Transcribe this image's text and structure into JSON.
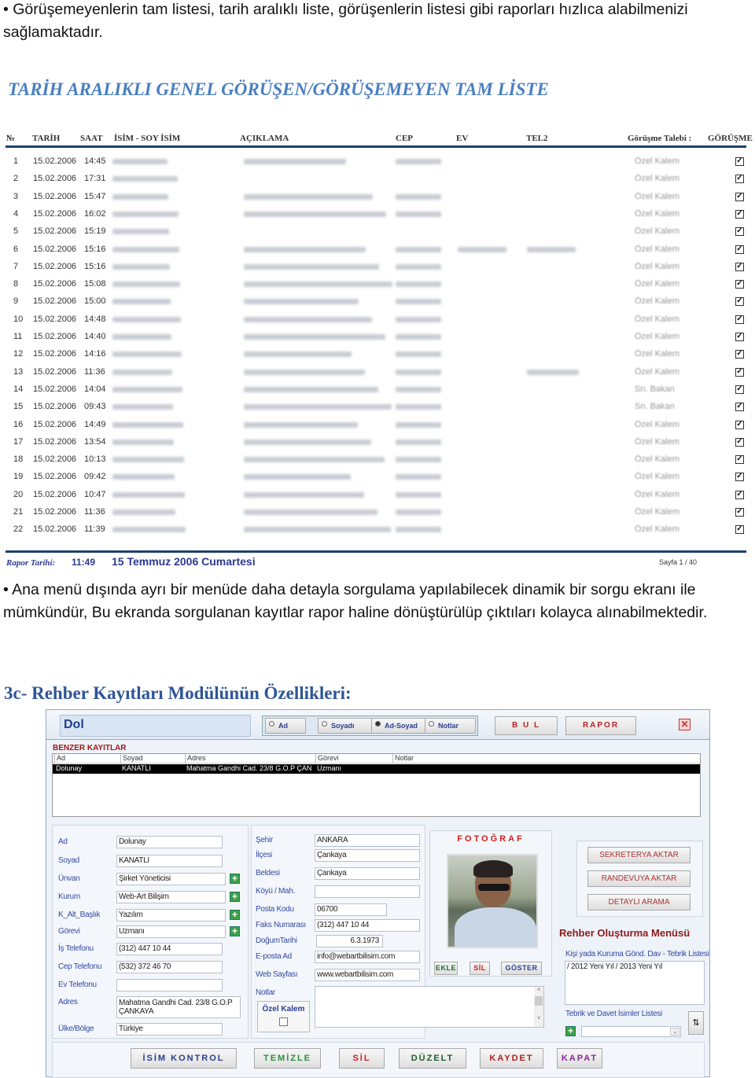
{
  "intro": "• Görüşemeyenlerin tam listesi, tarih aralıklı liste, görüşenlerin listesi gibi raporları hızlıca alabilmenizi sağlamaktadır.",
  "report_heading": "TARİH ARALIKLI GENEL GÖRÜŞEN/GÖRÜŞEMEYEN TAM LİSTE",
  "report": {
    "columns": [
      "№",
      "TARİH",
      "SAAT",
      "İSİM - SOY İSİM",
      "AÇIKLAMA",
      "CEP",
      "EV",
      "TEL2",
      "Görüşme Talebi :",
      "GÖRÜŞME"
    ],
    "rows": [
      {
        "no": "1",
        "date": "15.02.2006",
        "time": "14:45",
        "talep": "Özel Kalem",
        "checked": true
      },
      {
        "no": "2",
        "date": "15.02.2006",
        "time": "17:31",
        "talep": "Özel Kalem",
        "checked": true
      },
      {
        "no": "3",
        "date": "15.02.2006",
        "time": "15:47",
        "talep": "Özel Kalem",
        "checked": true
      },
      {
        "no": "4",
        "date": "15.02.2006",
        "time": "16:02",
        "talep": "Özel Kalem",
        "checked": true
      },
      {
        "no": "5",
        "date": "15.02.2006",
        "time": "15:19",
        "talep": "Özel Kalem",
        "checked": true
      },
      {
        "no": "6",
        "date": "15.02.2006",
        "time": "15:16",
        "talep": "Özel Kalem",
        "checked": true
      },
      {
        "no": "7",
        "date": "15.02.2006",
        "time": "15:16",
        "talep": "Özel Kalem",
        "checked": true
      },
      {
        "no": "8",
        "date": "15.02.2006",
        "time": "15:08",
        "talep": "Özel Kalem",
        "checked": true
      },
      {
        "no": "9",
        "date": "15.02.2006",
        "time": "15:00",
        "talep": "Özel Kalem",
        "checked": true
      },
      {
        "no": "10",
        "date": "15.02.2006",
        "time": "14:48",
        "talep": "Özel Kalem",
        "checked": true
      },
      {
        "no": "11",
        "date": "15.02.2006",
        "time": "14:40",
        "talep": "Özel Kalem",
        "checked": true
      },
      {
        "no": "12",
        "date": "15.02.2006",
        "time": "14:16",
        "talep": "Özel Kalem",
        "checked": true
      },
      {
        "no": "13",
        "date": "15.02.2006",
        "time": "11:36",
        "talep": "Özel Kalem",
        "checked": true
      },
      {
        "no": "14",
        "date": "15.02.2006",
        "time": "14:04",
        "talep": "Sn. Bakan",
        "checked": true
      },
      {
        "no": "15",
        "date": "15.02.2006",
        "time": "09:43",
        "talep": "Sn. Bakan",
        "checked": true
      },
      {
        "no": "16",
        "date": "15.02.2006",
        "time": "14:49",
        "talep": "Özel Kalem",
        "checked": true
      },
      {
        "no": "17",
        "date": "15.02.2006",
        "time": "13:54",
        "talep": "Özel Kalem",
        "checked": true
      },
      {
        "no": "18",
        "date": "15.02.2006",
        "time": "10:13",
        "talep": "Özel Kalem",
        "checked": true
      },
      {
        "no": "19",
        "date": "15.02.2006",
        "time": "09:42",
        "talep": "Özel Kalem",
        "checked": true
      },
      {
        "no": "20",
        "date": "15.02.2006",
        "time": "10:47",
        "talep": "Özel Kalem",
        "checked": true
      },
      {
        "no": "21",
        "date": "15.02.2006",
        "time": "11:36",
        "talep": "Özel Kalem",
        "checked": true
      },
      {
        "no": "22",
        "date": "15.02.2006",
        "time": "11:39",
        "talep": "Özel Kalem",
        "checked": true
      }
    ],
    "footer": {
      "label": "Rapor Tarihi:",
      "time": "11:49",
      "date": "15 Temmuz 2006 Cumartesi",
      "page": "Sayfa 1 / 40"
    }
  },
  "para2": "• Ana menü dışında ayrı bir menüde daha detayla sorgulama yapılabilecek dinamik bir  sorgu ekranı ile mümkündür, Bu ekranda sorgulanan kayıtlar rapor haline dönüştürülüp çıktıları kolayca alınabilmektedir.",
  "section_heading": "3c- Rehber Kayıtları Modülünün Özellikleri:",
  "app": {
    "search_value": "Dol",
    "radios": [
      {
        "label": "Ad",
        "selected": false
      },
      {
        "label": "Soyadı",
        "selected": false
      },
      {
        "label": "Ad-Soyad",
        "selected": true
      },
      {
        "label": "Notlar",
        "selected": false
      }
    ],
    "bul": "B U L",
    "rapor": "RAPOR",
    "similar_title": "BENZER KAYITLAR",
    "similar_columns": [
      "Ad",
      "Soyad",
      "Adres",
      "Görevi",
      "Notlar"
    ],
    "similar_rows": [
      [
        "Dolunay",
        "KANATLI",
        "Mahatma Gandhi Cad. 23/8 G.O.P ÇAN",
        "Uzmanı",
        ""
      ]
    ],
    "left_fields": [
      {
        "label": "Ad",
        "value": "Dolunay"
      },
      {
        "label": "Soyad",
        "value": "KANATLI"
      },
      {
        "label": "Ünvan",
        "value": "Şirket Yöneticisi",
        "dropdown": true
      },
      {
        "label": "Kurum",
        "value": "Web-Art Bilişim",
        "dropdown": true
      },
      {
        "label": "K_Alt_Başlık",
        "value": "Yazılım",
        "dropdown": true
      },
      {
        "label": "Görevi",
        "value": "Uzmanı",
        "dropdown": true
      },
      {
        "label": "İş Telefonu",
        "value": "(312) 447 10 44"
      },
      {
        "label": "Cep Telefonu",
        "value": "(532) 372 46 70"
      },
      {
        "label": "Ev Telefonu",
        "value": ""
      },
      {
        "label": "Adres",
        "value": "Mahatma Gandhi Cad. 23/8 G.O.P ÇANKAYA"
      },
      {
        "label": "Ülke/Bölge",
        "value": "Türkiye"
      }
    ],
    "mid_fields": [
      {
        "label": "Şehir",
        "value": "ANKARA",
        "dropdown": true
      },
      {
        "label": "İlçesi",
        "value": "Çankaya",
        "dropdown": true
      },
      {
        "label": "Beldesi",
        "value": "Çankaya",
        "dropdown": true
      },
      {
        "label": "Köyü / Mah.",
        "value": "",
        "dropdown": true
      },
      {
        "label": "Posta Kodu",
        "value": "06700"
      },
      {
        "label": "Faks Numarası",
        "value": "(312) 447 10 44"
      },
      {
        "label": "DoğumTarihi",
        "value": "6.3.1973"
      },
      {
        "label": "E-posta Ad",
        "value": "info@webartbilisim.com"
      },
      {
        "label": "Web Sayfası",
        "value": "www.webartbilisim.com"
      }
    ],
    "notes_label": "Notlar",
    "ozel_kalem": "Özel Kalem",
    "photo_title": "FOTOĞRAF",
    "photo_buttons": [
      "EKLE",
      "SİL",
      "GÖSTER"
    ],
    "side_buttons": [
      "SEKRETERYA AKTAR",
      "RANDEVUYA AKTAR",
      "DETAYLI ARAMA"
    ],
    "menu_title": "Rehber Oluşturma Menüsü",
    "list_label": "Kişi yada Kuruma Gönd. Dav - Tebrik Listesi",
    "list_value": "/ 2012 Yeni Yıl / 2013 Yeni Yıl",
    "names_label": "Tebrik ve Davet İsimler Listesi",
    "bottom_buttons": [
      {
        "label": "İSİM KONTROL",
        "color": "#2a3f8f"
      },
      {
        "label": "TEMİZLE",
        "color": "#2f8f3a"
      },
      {
        "label": "SİL",
        "color": "#d02020"
      },
      {
        "label": "DÜZELT",
        "color": "#1e5d2a"
      },
      {
        "label": "KAYDET",
        "color": "#b02020"
      },
      {
        "label": "KAPAT",
        "color": "#8a2a9a"
      }
    ]
  }
}
